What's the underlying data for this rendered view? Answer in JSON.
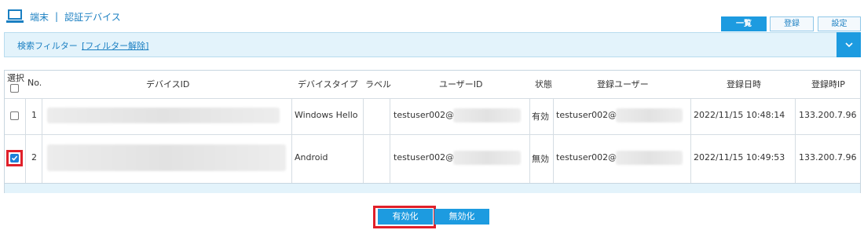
{
  "header": {
    "section": "端末",
    "separator": "|",
    "title": "認証デバイス",
    "icon": "laptop-icon"
  },
  "tabs": [
    {
      "label": "一覧",
      "active": true
    },
    {
      "label": "登録",
      "active": false
    },
    {
      "label": "設定",
      "active": false
    }
  ],
  "filter": {
    "label": "検索フィルター",
    "clear_link": "[フィルター解除]",
    "toggle_icon": "chevron-down-icon"
  },
  "table": {
    "columns": {
      "select": "選択",
      "no": "No.",
      "device_id": "デバイスID",
      "device_type": "デバイスタイプ",
      "label": "ラベル",
      "user_id": "ユーザーID",
      "status": "状態",
      "registered_user": "登録ユーザー",
      "registered_at": "登録日時",
      "registered_ip": "登録時IP"
    },
    "rows": [
      {
        "checked": false,
        "no": "1",
        "device_type": "Windows Hello",
        "label": "",
        "user_id": "testuser002@",
        "status": "有効",
        "registered_user": "testuser002@",
        "registered_at": "2022/11/15 10:48:14",
        "registered_ip": "133.200.7.96"
      },
      {
        "checked": true,
        "no": "2",
        "device_type": "Android",
        "label": "",
        "user_id": "testuser002@",
        "status": "無効",
        "registered_user": "testuser002@",
        "registered_at": "2022/11/15 10:49:53",
        "registered_ip": "133.200.7.96"
      }
    ]
  },
  "actions": {
    "enable": "有効化",
    "disable": "無効化"
  },
  "colors": {
    "accent": "#1d9be0",
    "link": "#1a7fc2",
    "highlight": "#e0202a"
  }
}
